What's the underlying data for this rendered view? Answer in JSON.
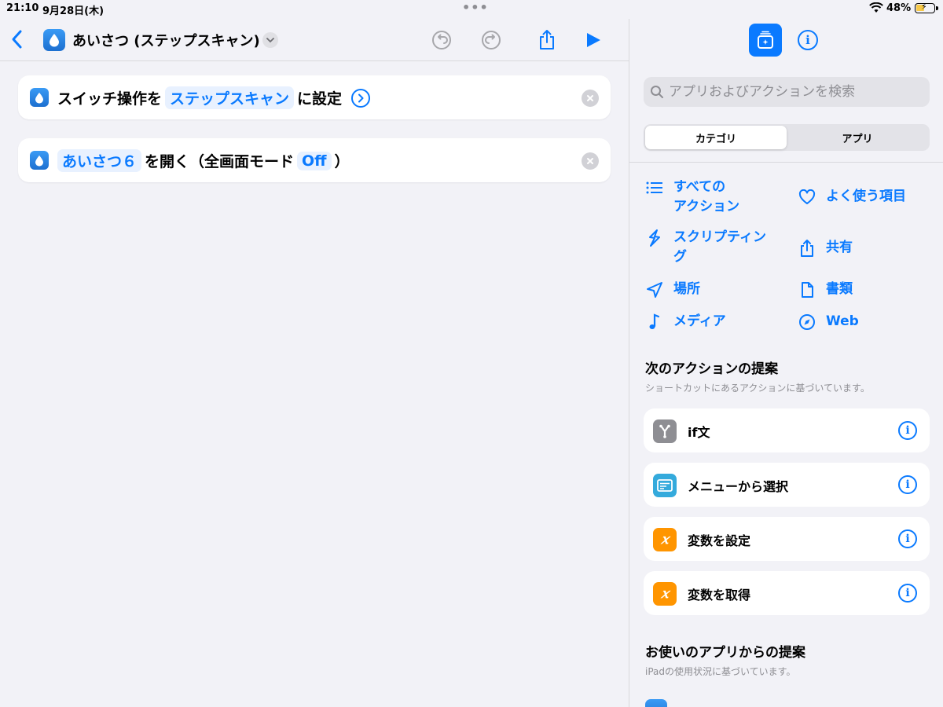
{
  "status": {
    "time": "21:10",
    "date": "9月28日(木)",
    "battery": "48%",
    "battery_level": 0.48
  },
  "editor": {
    "title": "あいさつ (ステップスキャン)",
    "icons": [
      "chevron-left-icon",
      "drop-icon",
      "undo-icon",
      "redo-icon",
      "share-icon",
      "play-icon"
    ],
    "actions": [
      {
        "prefix": "スイッチ操作を",
        "token": "ステップスキャン",
        "suffix": "に設定"
      },
      {
        "token1": "あいさつ６",
        "mid": "を開く（全画面モード",
        "token2": "Off",
        "suffix": "）"
      }
    ]
  },
  "panel": {
    "search_placeholder": "アプリおよびアクションを検索",
    "segments": [
      "カテゴリ",
      "アプリ"
    ],
    "categories": [
      {
        "label": "すべての\nアクション",
        "icon": "list-icon"
      },
      {
        "label": "よく使う項目",
        "icon": "heart-icon"
      },
      {
        "label": "スクリプティング",
        "icon": "scripting-icon"
      },
      {
        "label": "共有",
        "icon": "share-icon"
      },
      {
        "label": "場所",
        "icon": "location-icon"
      },
      {
        "label": "書類",
        "icon": "document-icon"
      },
      {
        "label": "メディア",
        "icon": "music-note-icon"
      },
      {
        "label": "Web",
        "icon": "compass-icon"
      }
    ],
    "next_title": "次のアクションの提案",
    "next_sub": "ショートカットにあるアクションに基づいています。",
    "suggestions": [
      {
        "label": "if文",
        "icon": "branch-icon",
        "color": "#8e8e93"
      },
      {
        "label": "メニューから選択",
        "icon": "menu-icon",
        "color": "#34aadc"
      },
      {
        "label": "変数を設定",
        "icon": "variable-icon",
        "color": "#ff9500"
      },
      {
        "label": "変数を取得",
        "icon": "variable-icon",
        "color": "#ff9500"
      }
    ],
    "apps_title": "お使いのアプリからの提案",
    "apps_sub": "iPadの使用状況に基づいています。"
  }
}
